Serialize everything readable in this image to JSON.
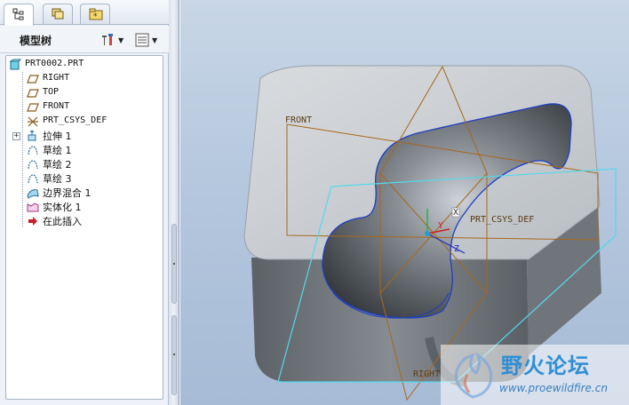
{
  "tree_panel": {
    "title": "模型树",
    "tabs": [
      {
        "name": "model-tree-tab-icon"
      },
      {
        "name": "layers-tab-icon"
      },
      {
        "name": "folder-favorites-tab-icon"
      }
    ],
    "settings_icon": "tools-icon",
    "show_icon": "tree-columns-icon",
    "items": [
      {
        "label": "PRT0002.PRT",
        "icon": "part-icon"
      },
      {
        "label": "RIGHT",
        "icon": "datum-plane-icon"
      },
      {
        "label": "TOP",
        "icon": "datum-plane-icon"
      },
      {
        "label": "FRONT",
        "icon": "datum-plane-icon"
      },
      {
        "label": "PRT_CSYS_DEF",
        "icon": "coordinate-system-icon"
      },
      {
        "label": "拉伸 1",
        "icon": "extrude-icon"
      },
      {
        "label": "草绘 1",
        "icon": "sketch-icon"
      },
      {
        "label": "草绘 2",
        "icon": "sketch-icon"
      },
      {
        "label": "草绘 3",
        "icon": "sketch-icon"
      },
      {
        "label": "边界混合 1",
        "icon": "boundary-blend-icon"
      },
      {
        "label": "实体化 1",
        "icon": "solidify-icon"
      },
      {
        "label": "在此插入",
        "icon": "insert-here-arrow-icon"
      }
    ]
  },
  "viewport": {
    "plane_labels": {
      "front": "FRONT",
      "csys": "PRT_CSYS_DEF",
      "right": "RIGHT"
    },
    "axis_labels": {
      "y": "Y",
      "x": "X",
      "z": "Z"
    },
    "colors": {
      "background_top": "#c8d6e6",
      "background_bottom": "#a7bbd6",
      "datum_plane": "#a8671c",
      "selected_plane": "#54d8ec",
      "model_face": "#c9ccd0",
      "model_side": "#6b7076",
      "cavity_edge": "#1f3fbf"
    }
  },
  "watermark": {
    "title": "野火论坛",
    "url": "www.proewildfire.cn"
  }
}
